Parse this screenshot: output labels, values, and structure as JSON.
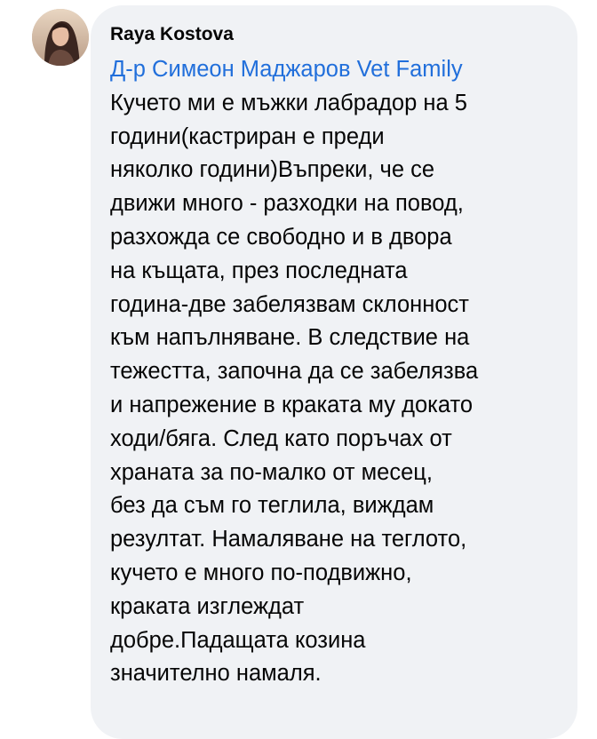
{
  "comment": {
    "author": "Raya Kostova",
    "mention": "Д-р Симеон Маджаров Vet Family",
    "lines": [
      "Кучето ми е мъжки лабрадор на 5",
      "години(кастриран е преди",
      "няколко години)Въпреки, че се",
      "движи много - разходки на повод,",
      "разхожда се  свободно и в двора",
      "на къщата, през последната",
      "година-две забелязвам склонност",
      "към напълняване. В следствие на",
      "тежестта, започна да се забелязва",
      "и напрежение в краката му докато",
      "ходи/бяга. След като поръчах от",
      "храната за по-малко от месец,",
      "без да съм го теглила, виждам",
      "резултат. Намаляване на теглото,",
      "кучето е много по-подвижно,",
      "краката изглеждат",
      "добре.Падащата козина",
      "значително намаля."
    ]
  },
  "colors": {
    "bubble_background": "#f0f2f5",
    "mention_link": "#216fdb",
    "text": "#050505"
  },
  "icons": {
    "avatar": "profile-photo"
  }
}
